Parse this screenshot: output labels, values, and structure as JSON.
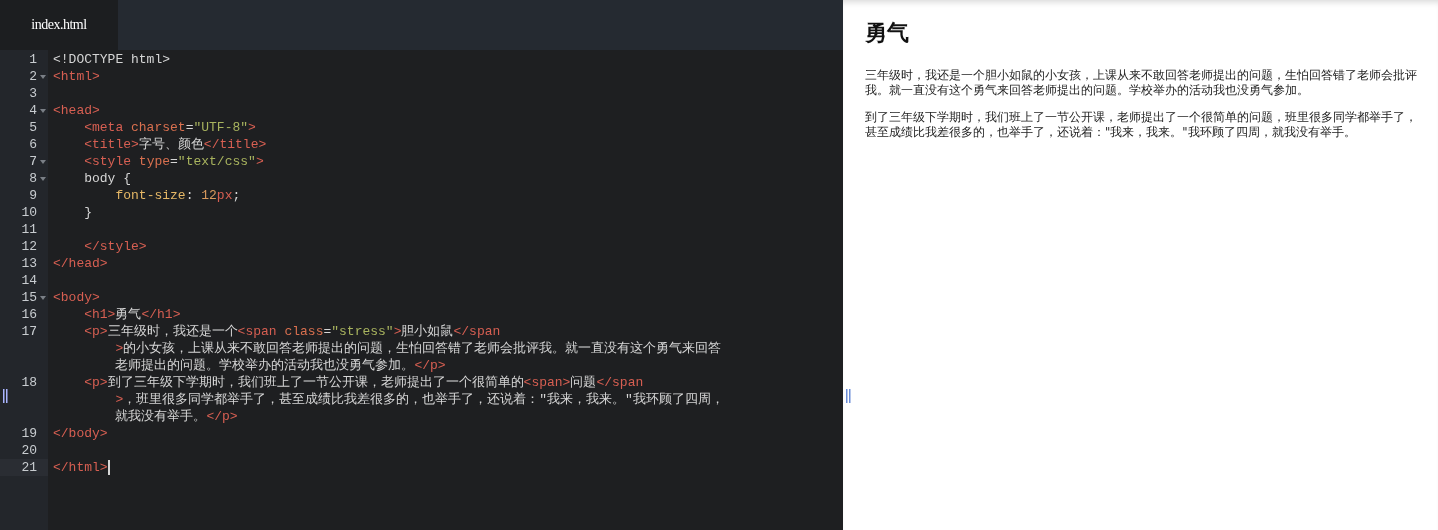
{
  "editor": {
    "tabs": [
      {
        "label": "index.html",
        "selected": true
      }
    ],
    "lines": [
      {
        "number": "1",
        "fold": false,
        "active": false,
        "rows": [
          [
            {
              "kind": "text",
              "text": "<!DOCTYPE html>"
            }
          ]
        ]
      },
      {
        "number": "2",
        "fold": true,
        "active": false,
        "rows": [
          [
            {
              "kind": "tag",
              "text": "<html>"
            }
          ]
        ]
      },
      {
        "number": "3",
        "fold": false,
        "active": false,
        "rows": [
          []
        ]
      },
      {
        "number": "4",
        "fold": true,
        "active": false,
        "rows": [
          [
            {
              "kind": "tag",
              "text": "<head>"
            }
          ]
        ]
      },
      {
        "number": "5",
        "fold": false,
        "active": false,
        "rows": [
          [
            {
              "kind": "tag",
              "text": "    <meta "
            },
            {
              "kind": "attr",
              "text": "charset"
            },
            {
              "kind": "text",
              "text": "="
            },
            {
              "kind": "string",
              "text": "\"UTF-8\""
            },
            {
              "kind": "tag",
              "text": ">"
            }
          ]
        ]
      },
      {
        "number": "6",
        "fold": false,
        "active": false,
        "rows": [
          [
            {
              "kind": "tag",
              "text": "    <title>"
            },
            {
              "kind": "text",
              "text": "字号、颜色"
            },
            {
              "kind": "tag",
              "text": "</title>"
            }
          ]
        ]
      },
      {
        "number": "7",
        "fold": true,
        "active": false,
        "rows": [
          [
            {
              "kind": "tag",
              "text": "    <style "
            },
            {
              "kind": "attr",
              "text": "type"
            },
            {
              "kind": "text",
              "text": "="
            },
            {
              "kind": "string",
              "text": "\"text/css\""
            },
            {
              "kind": "tag",
              "text": ">"
            }
          ]
        ]
      },
      {
        "number": "8",
        "fold": true,
        "active": false,
        "rows": [
          [
            {
              "kind": "text",
              "text": "    body {"
            }
          ]
        ]
      },
      {
        "number": "9",
        "fold": false,
        "active": false,
        "rows": [
          [
            {
              "kind": "text",
              "text": "        "
            },
            {
              "kind": "prop",
              "text": "font-size"
            },
            {
              "kind": "text",
              "text": ": "
            },
            {
              "kind": "num",
              "text": "12"
            },
            {
              "kind": "unit",
              "text": "px"
            },
            {
              "kind": "text",
              "text": ";"
            }
          ]
        ]
      },
      {
        "number": "10",
        "fold": false,
        "active": false,
        "rows": [
          [
            {
              "kind": "text",
              "text": "    }"
            }
          ]
        ]
      },
      {
        "number": "11",
        "fold": false,
        "active": false,
        "rows": [
          []
        ]
      },
      {
        "number": "12",
        "fold": false,
        "active": false,
        "rows": [
          [
            {
              "kind": "tag",
              "text": "    </style>"
            }
          ]
        ]
      },
      {
        "number": "13",
        "fold": false,
        "active": false,
        "rows": [
          [
            {
              "kind": "tag",
              "text": "</head>"
            }
          ]
        ]
      },
      {
        "number": "14",
        "fold": false,
        "active": false,
        "rows": [
          []
        ]
      },
      {
        "number": "15",
        "fold": true,
        "active": false,
        "rows": [
          [
            {
              "kind": "tag",
              "text": "<body>"
            }
          ]
        ]
      },
      {
        "number": "16",
        "fold": false,
        "active": false,
        "rows": [
          [
            {
              "kind": "tag",
              "text": "    <h1>"
            },
            {
              "kind": "text",
              "text": "勇气"
            },
            {
              "kind": "tag",
              "text": "</h1>"
            }
          ]
        ]
      },
      {
        "number": "17",
        "fold": false,
        "active": false,
        "rows": [
          [
            {
              "kind": "tag",
              "text": "    <p>"
            },
            {
              "kind": "text",
              "text": "三年级时，我还是一个"
            },
            {
              "kind": "tag",
              "text": "<span "
            },
            {
              "kind": "attr",
              "text": "class"
            },
            {
              "kind": "text",
              "text": "="
            },
            {
              "kind": "string",
              "text": "\"stress\""
            },
            {
              "kind": "tag",
              "text": ">"
            },
            {
              "kind": "text",
              "text": "胆小如鼠"
            },
            {
              "kind": "tag",
              "text": "</span"
            }
          ],
          [
            {
              "kind": "tag",
              "text": "        >"
            },
            {
              "kind": "text",
              "text": "的小女孩，上课从来不敢回答老师提出的问题，生怕回答错了老师会批评我。就一直没有这个勇气来回答"
            }
          ],
          [
            {
              "kind": "text",
              "text": "        老师提出的问题。学校举办的活动我也没勇气参加。"
            },
            {
              "kind": "tag",
              "text": "</p>"
            }
          ]
        ]
      },
      {
        "number": "18",
        "fold": false,
        "active": false,
        "rows": [
          [
            {
              "kind": "tag",
              "text": "    <p>"
            },
            {
              "kind": "text",
              "text": "到了三年级下学期时，我们班上了一节公开课，老师提出了一个很简单的"
            },
            {
              "kind": "tag",
              "text": "<span>"
            },
            {
              "kind": "text",
              "text": "问题"
            },
            {
              "kind": "tag",
              "text": "</span"
            }
          ],
          [
            {
              "kind": "tag",
              "text": "        >"
            },
            {
              "kind": "text",
              "text": "，班里很多同学都举手了，甚至成绩比我差很多的，也举手了，还说着：\"我来，我来。\"我环顾了四周，"
            }
          ],
          [
            {
              "kind": "text",
              "text": "        就我没有举手。"
            },
            {
              "kind": "tag",
              "text": "</p>"
            }
          ]
        ]
      },
      {
        "number": "19",
        "fold": false,
        "active": false,
        "rows": [
          [
            {
              "kind": "tag",
              "text": "</body>"
            }
          ]
        ]
      },
      {
        "number": "20",
        "fold": false,
        "active": false,
        "rows": [
          []
        ]
      },
      {
        "number": "21",
        "fold": false,
        "active": true,
        "rows": [
          [
            {
              "kind": "tag",
              "text": "</html>"
            }
          ]
        ]
      }
    ]
  },
  "preview": {
    "heading": "勇气",
    "paragraphs": [
      "三年级时，我还是一个胆小如鼠的小女孩，上课从来不敢回答老师提出的问题，生怕回答错了老师会批评我。就一直没有这个勇气来回答老师提出的问题。学校举办的活动我也没勇气参加。",
      "到了三年级下学期时，我们班上了一节公开课，老师提出了一个很简单的问题，班里很多同学都举手了，甚至成绩比我差很多的，也举手了，还说着：\"我来，我来。\"我环顾了四周，就我没有举手。"
    ]
  }
}
